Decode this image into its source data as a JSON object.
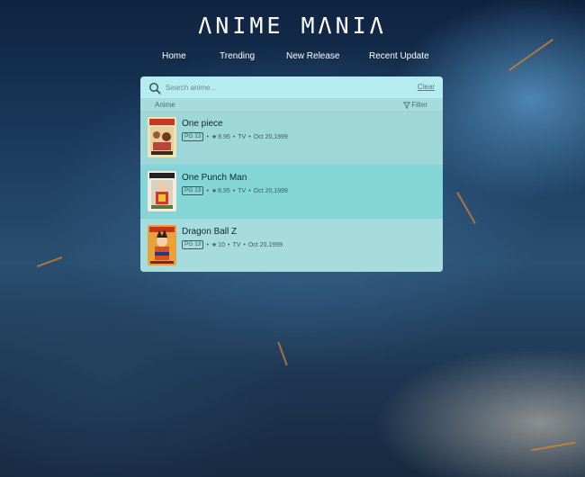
{
  "app": {
    "title": "ΛNIME MΛNIΛ"
  },
  "nav": {
    "items": [
      {
        "label": "Home"
      },
      {
        "label": "Trending"
      },
      {
        "label": "New Release"
      },
      {
        "label": "Recent Update"
      }
    ]
  },
  "search": {
    "placeholder": "Search anime...",
    "value": "",
    "clear_label": "Clear"
  },
  "list": {
    "header_label": "Anime",
    "filter_label": "Filter",
    "items": [
      {
        "title": "One piece",
        "rating": "PG 13",
        "score": "8.95",
        "type": "TV",
        "date": "Oct 20,1999"
      },
      {
        "title": "One Punch Man",
        "rating": "PG 13",
        "score": "8.95",
        "type": "TV",
        "date": "Oct 20,1999"
      },
      {
        "title": "Dragon Ball Z",
        "rating": "PG 13",
        "score": "10",
        "type": "TV",
        "date": "Oct 20,1999"
      }
    ]
  },
  "colors": {
    "panel_bg": "#a6dcdd",
    "search_bg": "#b4ecef",
    "hover_row_bg": "#84d5d6",
    "title_text": "#ffffff"
  },
  "icons": {
    "search": "search-icon",
    "filter": "filter-icon",
    "star": "star-icon"
  }
}
